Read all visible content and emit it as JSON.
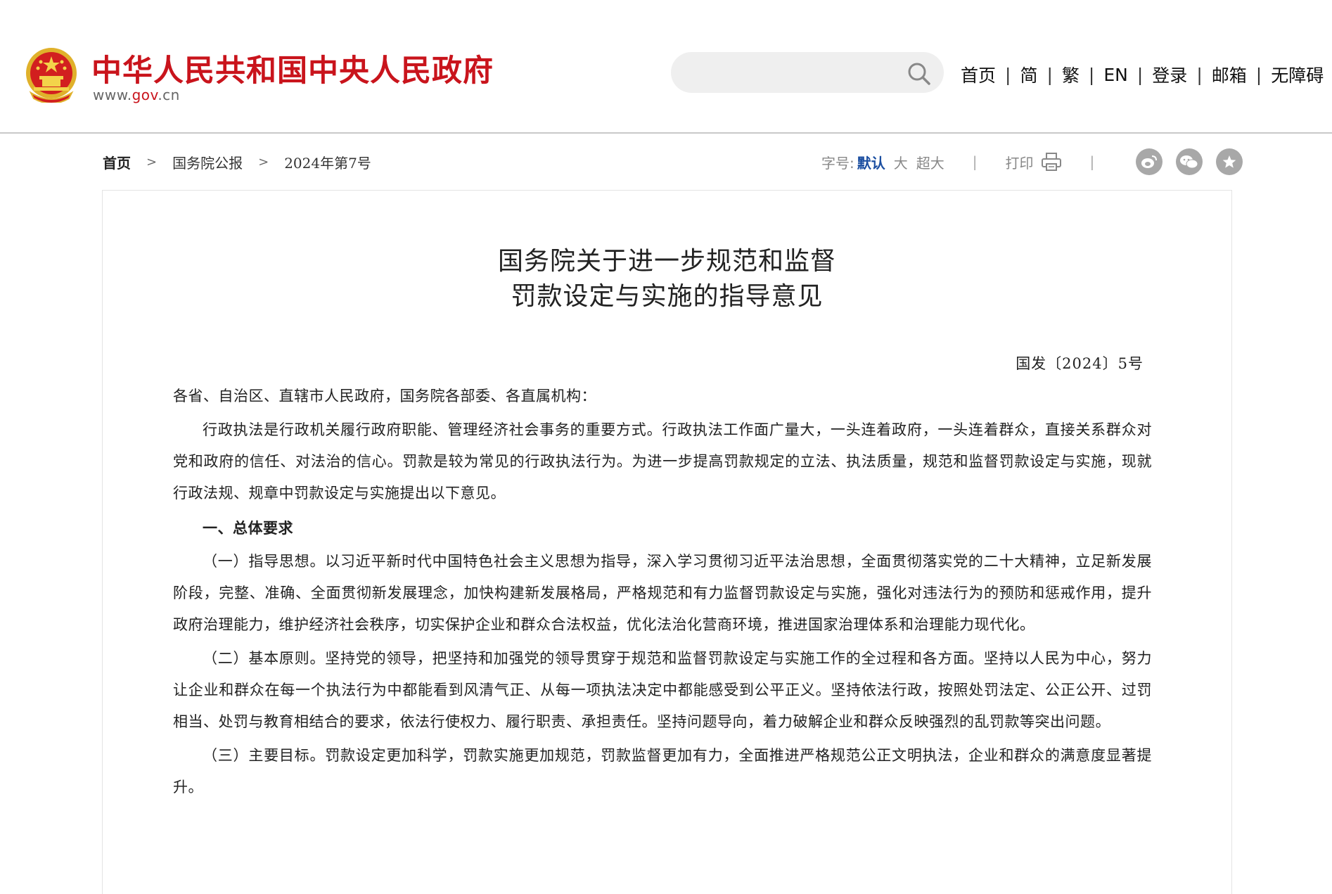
{
  "header": {
    "site_title": "中华人民共和国中央人民政府",
    "site_domain_prefix": "www.",
    "site_domain_gov": "gov",
    "site_domain_suffix": ".cn",
    "search": {
      "placeholder": "",
      "value": ""
    },
    "nav": [
      "首页",
      "简",
      "繁",
      "EN",
      "登录",
      "邮箱",
      "无障碍"
    ]
  },
  "breadcrumb": [
    "首页",
    "国务院公报",
    "2024年第7号"
  ],
  "tools": {
    "font_size_label": "字号:",
    "font_sizes": [
      "默认",
      "大",
      "超大"
    ],
    "print_label": "打印"
  },
  "share_icons": [
    "weibo-icon",
    "wechat-icon",
    "favorite-icon"
  ],
  "article": {
    "title_line1": "国务院关于进一步规范和监督",
    "title_line2": "罚款设定与实施的指导意见",
    "doc_number": "国发〔2024〕5号",
    "salutation": "各省、自治区、直辖市人民政府，国务院各部委、各直属机构：",
    "para1": "行政执法是行政机关履行政府职能、管理经济社会事务的重要方式。行政执法工作面广量大，一头连着政府，一头连着群众，直接关系群众对党和政府的信任、对法治的信心。罚款是较为常见的行政执法行为。为进一步提高罚款规定的立法、执法质量，规范和监督罚款设定与实施，现就行政法规、规章中罚款设定与实施提出以下意见。",
    "section1": "一、总体要求",
    "item1": "（一）指导思想。以习近平新时代中国特色社会主义思想为指导，深入学习贯彻习近平法治思想，全面贯彻落实党的二十大精神，立足新发展阶段，完整、准确、全面贯彻新发展理念，加快构建新发展格局，严格规范和有力监督罚款设定与实施，强化对违法行为的预防和惩戒作用，提升政府治理能力，维护经济社会秩序，切实保护企业和群众合法权益，优化法治化营商环境，推进国家治理体系和治理能力现代化。",
    "item2": "（二）基本原则。坚持党的领导，把坚持和加强党的领导贯穿于规范和监督罚款设定与实施工作的全过程和各方面。坚持以人民为中心，努力让企业和群众在每一个执法行为中都能看到风清气正、从每一项执法决定中都能感受到公平正义。坚持依法行政，按照处罚法定、公正公开、过罚相当、处罚与教育相结合的要求，依法行使权力、履行职责、承担责任。坚持问题导向，着力破解企业和群众反映强烈的乱罚款等突出问题。",
    "item3": "（三）主要目标。罚款设定更加科学，罚款实施更加规范，罚款监督更加有力，全面推进严格规范公正文明执法，企业和群众的满意度显著提升。"
  },
  "colors": {
    "brand_red": "#c9141c",
    "active_blue": "#1c4fa1",
    "icon_gray": "#a8a8a8"
  }
}
